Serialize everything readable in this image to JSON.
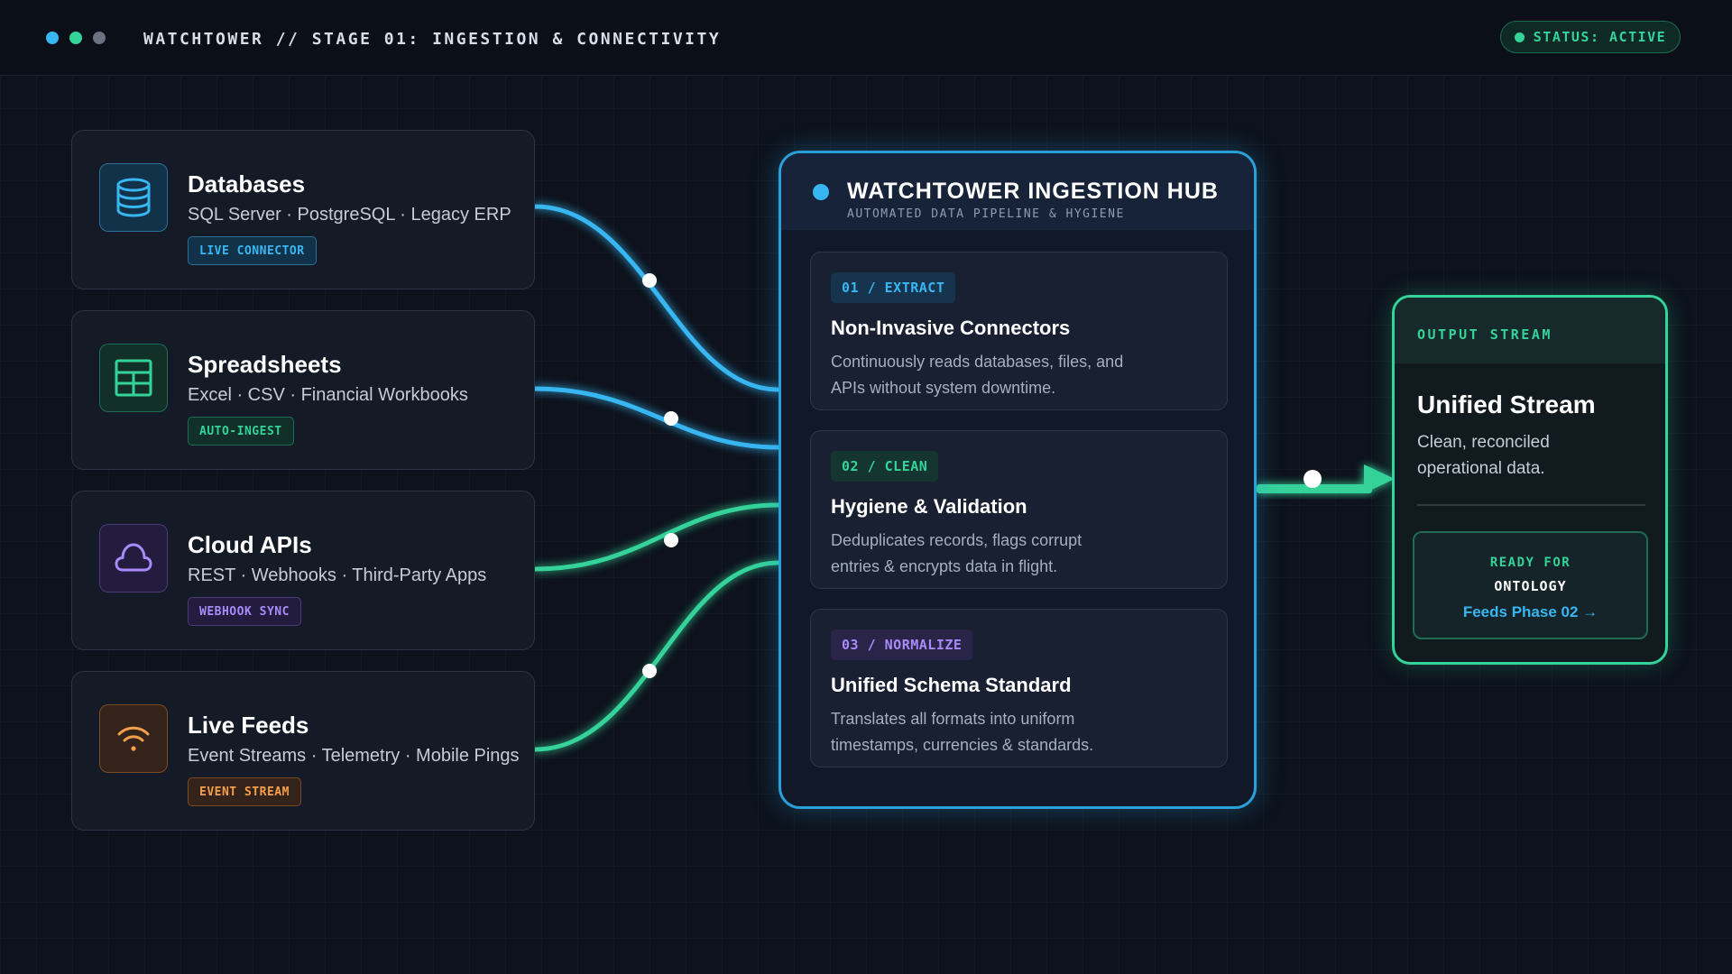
{
  "window": {
    "title": "WATCHTOWER // STAGE 01: INGESTION & CONNECTIVITY"
  },
  "status": {
    "label": "STATUS: ACTIVE",
    "color": "#34d399"
  },
  "colors": {
    "blue": "#38b6f2",
    "green": "#34d399",
    "purple": "#a78bfa",
    "orange": "#f59e4b",
    "hub_border": "#2b9fd7"
  },
  "sources": [
    {
      "title": "Databases",
      "subtitle": "SQL Server · PostgreSQL · Legacy ERP",
      "tag": "LIVE CONNECTOR",
      "icon": "database-icon",
      "color": "#38b6f2"
    },
    {
      "title": "Spreadsheets",
      "subtitle": "Excel · CSV · Financial Workbooks",
      "tag": "AUTO-INGEST",
      "icon": "table-icon",
      "color": "#34d399"
    },
    {
      "title": "Cloud APIs",
      "subtitle": "REST · Webhooks · Third-Party Apps",
      "tag": "WEBHOOK SYNC",
      "icon": "cloud-icon",
      "color": "#a78bfa"
    },
    {
      "title": "Live Feeds",
      "subtitle": "Event Streams · Telemetry · Mobile Pings",
      "tag": "EVENT STREAM",
      "icon": "wifi-icon",
      "color": "#f59e4b"
    }
  ],
  "hub": {
    "title": "WATCHTOWER INGESTION HUB",
    "subtitle": "AUTOMATED DATA PIPELINE & HYGIENE",
    "steps": [
      {
        "tag": "01 / EXTRACT",
        "title": "Non-Invasive Connectors",
        "desc": "Continuously reads databases, files, and APIs without system downtime.",
        "color": "#38b6f2"
      },
      {
        "tag": "02 / CLEAN",
        "title": "Hygiene & Validation",
        "desc": "Deduplicates records, flags corrupt entries & encrypts data in flight.",
        "color": "#34d399"
      },
      {
        "tag": "03 / NORMALIZE",
        "title": "Unified Schema Standard",
        "desc": "Translates all formats into uniform timestamps, currencies & standards.",
        "color": "#a78bfa"
      }
    ]
  },
  "output": {
    "label": "OUTPUT STREAM",
    "title": "Unified Stream",
    "desc": "Clean, reconciled operational data.",
    "ready_line1": "READY FOR",
    "ready_line2": "ONTOLOGY",
    "link": "Feeds Phase 02 →"
  }
}
